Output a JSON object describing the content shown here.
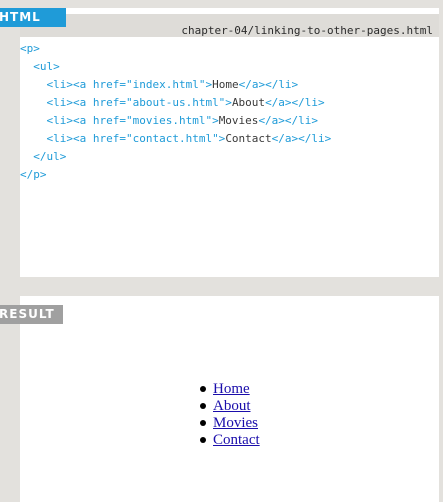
{
  "code_section": {
    "label": "HTML",
    "file_path": "chapter-04/linking-to-other-pages.html",
    "lines": [
      {
        "indent": 0,
        "prefix": "<p>",
        "text": "",
        "suffix": ""
      },
      {
        "indent": 2,
        "prefix": "<ul>",
        "text": "",
        "suffix": ""
      },
      {
        "indent": 4,
        "prefix": "<li><a href=\"index.html\">",
        "text": "Home",
        "suffix": "</a></li>"
      },
      {
        "indent": 4,
        "prefix": "<li><a href=\"about-us.html\">",
        "text": "About",
        "suffix": "</a></li>"
      },
      {
        "indent": 4,
        "prefix": "<li><a href=\"movies.html\">",
        "text": "Movies",
        "suffix": "</a></li>"
      },
      {
        "indent": 4,
        "prefix": "<li><a href=\"contact.html\">",
        "text": "Contact",
        "suffix": "</a></li>"
      },
      {
        "indent": 2,
        "prefix": "</ul>",
        "text": "",
        "suffix": ""
      },
      {
        "indent": 0,
        "prefix": "</p>",
        "text": "",
        "suffix": ""
      }
    ]
  },
  "result_section": {
    "label": "RESULT",
    "links": [
      {
        "label": "Home"
      },
      {
        "label": "About"
      },
      {
        "label": "Movies"
      },
      {
        "label": "Contact"
      }
    ]
  },
  "colors": {
    "html_tag": "#1f9bd8",
    "result_tag": "#a0a0a0",
    "background": "#e3e1dd",
    "code_markup": "#1f9bd8",
    "link": "#1a0dab"
  }
}
